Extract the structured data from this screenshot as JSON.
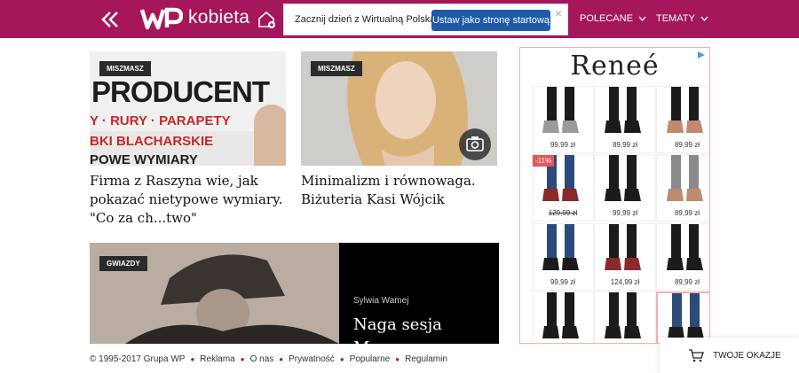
{
  "header": {
    "logo_text": "kobieta",
    "popup": {
      "message": "Zacznij dzień z Wirtualną Polską.",
      "button": "Ustaw jako stronę startową",
      "close": "×"
    },
    "nav": [
      {
        "label": "POLECANE"
      },
      {
        "label": "TEMATY"
      }
    ],
    "brand_color": "#a5175a"
  },
  "articles": [
    {
      "badge": "MISZMASZ",
      "title": "Firma z Raszyna wie, jak pokazać nietypowe wymiary. \"Co za ch...two\"",
      "banner": {
        "heading": "PRODUCENT",
        "line1": "Y · RURY · PARAPETY",
        "line2": "BKI  BLACHARSKIE",
        "line3": "POWE WYMIARY"
      }
    },
    {
      "badge": "MISZMASZ",
      "title": "Minimalizm i równowaga. Biżuteria Kasi Wójcik"
    },
    {
      "badge": "GWIAZDY",
      "author": "Sylwia Wamej",
      "title": "Naga sesja",
      "title_cut": "M"
    }
  ],
  "ad": {
    "brand": "Reneé",
    "tiles": [
      {
        "price": "99,99 zł"
      },
      {
        "price": "89,99 zł"
      },
      {
        "price": "89,99 zł"
      },
      {
        "price": "129,99 zł",
        "old": true,
        "discount": "-11%"
      },
      {
        "price": "99,99 zł"
      },
      {
        "price": "89,99 zł"
      },
      {
        "price": "99,99 zł"
      },
      {
        "price": "124,99 zł"
      },
      {
        "price": "89,99 zł"
      },
      {
        "price": ""
      },
      {
        "price": ""
      },
      {
        "price": ""
      }
    ]
  },
  "footer": {
    "copyright": "© 1995-2017 Grupa WP",
    "links": [
      "Reklama",
      "O nas",
      "Prywatność",
      "Popularne",
      "Regulamin"
    ]
  },
  "deals_button": "TWOJE OKAZJE"
}
